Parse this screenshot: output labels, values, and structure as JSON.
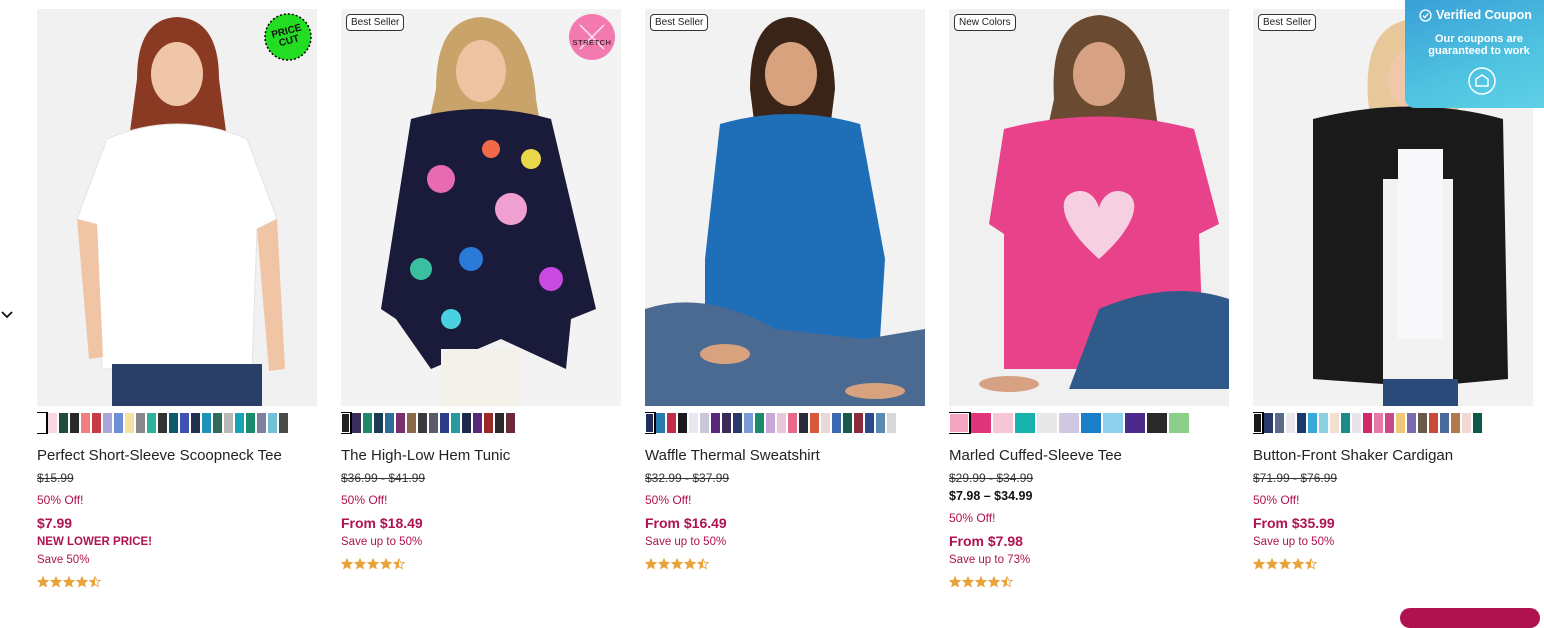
{
  "coupon": {
    "title": "Verified Coupon",
    "subtitle": "Our coupons are guaranteed to work",
    "icon": "coupon-icon"
  },
  "nav": {
    "icon": "chevron-down-icon"
  },
  "products": [
    {
      "badge": "",
      "emblem": "PRICE CUT",
      "name": "Perfect Short-Sleeve Scoopneck Tee",
      "original": "$15.99",
      "range": "",
      "off": "50% Off!",
      "price": "$7.99",
      "promo": "NEW LOWER PRICE!",
      "save": "Save 50%",
      "rating": 4.5,
      "swatches": [
        "#ffffff",
        "#f6d9e2",
        "#1d4d3c",
        "#2a2a2a",
        "#f08080",
        "#c73b46",
        "#a8a8d8",
        "#6c8fd8",
        "#f5e1a4",
        "#8a8a8a",
        "#2db39a",
        "#333333",
        "#0e5c6b",
        "#3f51b5",
        "#22314f",
        "#1c93b9",
        "#2f6b5a",
        "#b8b8b8",
        "#16a5b2",
        "#1a8c6a",
        "#7f7f9f",
        "#70c1d4",
        "#4a4a4a"
      ]
    },
    {
      "badge": "Best Seller",
      "emblem": "STRETCH",
      "name": "The High-Low Hem Tunic",
      "original": "$36.99 - $41.99",
      "range": "",
      "off": "50% Off!",
      "price": "From $18.49",
      "promo": "",
      "save": "Save up to 50%",
      "rating": 4.5,
      "swatches": [
        "#222222",
        "#3a2f5a",
        "#1e8a6a",
        "#1a3c56",
        "#2b6e9a",
        "#7a2f6a",
        "#8a6a4a",
        "#3a3a3a",
        "#5a5a6a",
        "#2a3f8a",
        "#2a9aa0",
        "#1f2a4a",
        "#5a2a7a",
        "#9a2a2a",
        "#2a2a2a",
        "#6a2a3a"
      ]
    },
    {
      "badge": "Best Seller",
      "emblem": "",
      "name": "Waffle Thermal Sweatshirt",
      "original": "$32.99 - $37.99",
      "range": "",
      "off": "50% Off!",
      "price": "From $16.49",
      "promo": "",
      "save": "Save up to 50%",
      "rating": 4.5,
      "swatches": [
        "#1f2f5a",
        "#2a7ab0",
        "#c42a4a",
        "#1a1a1a",
        "#e8e8ee",
        "#c8c8d8",
        "#5a2a7a",
        "#3a2a5a",
        "#2a3a6a",
        "#7a9ad8",
        "#1a8a6a",
        "#c8a8d8",
        "#e8c8d8",
        "#e86a8a",
        "#2a2a3a",
        "#d85a3a",
        "#e8d8d8",
        "#3a6ab0",
        "#1a5a4a",
        "#8a2a3a",
        "#2a4a8a",
        "#5a8ab0",
        "#d8d8d8"
      ]
    },
    {
      "badge": "New Colors",
      "emblem": "",
      "name": "Marled Cuffed-Sleeve Tee",
      "original": "$29.99 - $34.99",
      "range": "$7.98 – $34.99",
      "off": "50% Off!",
      "price": "From $7.98",
      "promo": "",
      "save": "Save up to 73%",
      "rating": 4.5,
      "swatches": [
        "#f2a4c0",
        "#e0357a",
        "#f4c6d8",
        "#18b2ad",
        "#e8e8e8",
        "#cfc8e0",
        "#1a7ec8",
        "#8fd0ec",
        "#4a2a8a",
        "#2a2a2a",
        "#8ccf8a"
      ]
    },
    {
      "badge": "Best Seller",
      "emblem": "",
      "name": "Button-Front Shaker Cardigan",
      "original": "$71.99 - $76.99",
      "range": "",
      "off": "50% Off!",
      "price": "From $35.99",
      "promo": "",
      "save": "Save up to 50%",
      "rating": 4.5,
      "swatches": [
        "#1a1a1a",
        "#2a3a6a",
        "#5a6a8a",
        "#e8e8ee",
        "#1a3a6a",
        "#38a8d8",
        "#8ad0e0",
        "#f0e0d0",
        "#1f8a8a",
        "#e6e6ea",
        "#d02a6a",
        "#e87aa8",
        "#c84a8a",
        "#f0c87a",
        "#7a6ab0",
        "#6a5a4a",
        "#c84a3a",
        "#4a6a9a",
        "#b07a4a",
        "#f4d8d8",
        "#0e5a4a"
      ]
    }
  ]
}
